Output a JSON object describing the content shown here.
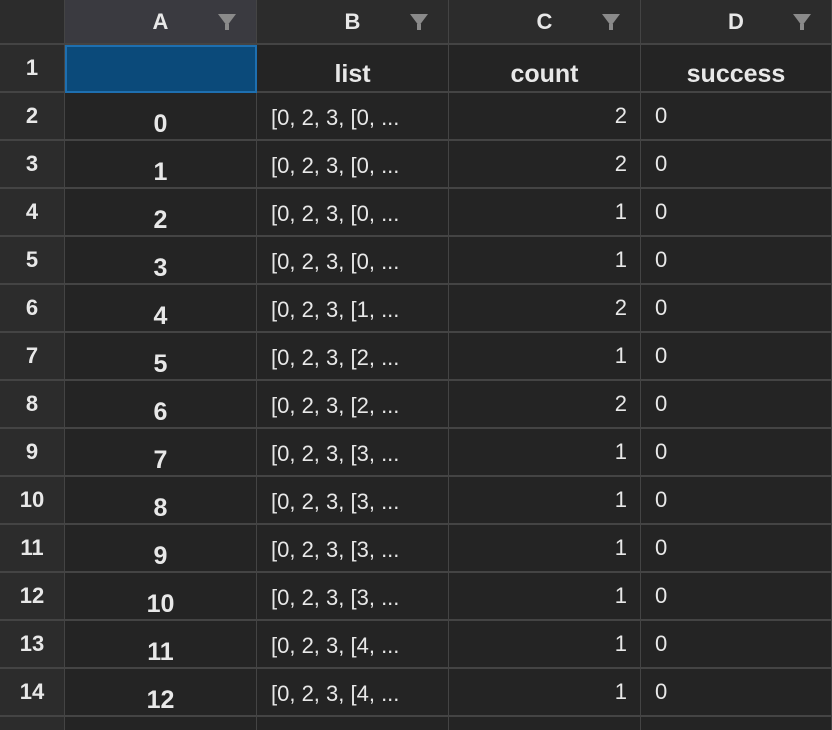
{
  "columns": [
    {
      "letter": "A"
    },
    {
      "letter": "B"
    },
    {
      "letter": "C"
    },
    {
      "letter": "D"
    }
  ],
  "header_row": {
    "row_number": "1",
    "index": "",
    "list": "list",
    "count": "count",
    "success": "success"
  },
  "rows": [
    {
      "row_number": "2",
      "index": "0",
      "list": "[0, 2, 3, [0, ...",
      "count": "2",
      "success": "0"
    },
    {
      "row_number": "3",
      "index": "1",
      "list": "[0, 2, 3, [0, ...",
      "count": "2",
      "success": "0"
    },
    {
      "row_number": "4",
      "index": "2",
      "list": "[0, 2, 3, [0, ...",
      "count": "1",
      "success": "0"
    },
    {
      "row_number": "5",
      "index": "3",
      "list": "[0, 2, 3, [0, ...",
      "count": "1",
      "success": "0"
    },
    {
      "row_number": "6",
      "index": "4",
      "list": "[0, 2, 3, [1, ...",
      "count": "2",
      "success": "0"
    },
    {
      "row_number": "7",
      "index": "5",
      "list": "[0, 2, 3, [2, ...",
      "count": "1",
      "success": "0"
    },
    {
      "row_number": "8",
      "index": "6",
      "list": "[0, 2, 3, [2, ...",
      "count": "2",
      "success": "0"
    },
    {
      "row_number": "9",
      "index": "7",
      "list": "[0, 2, 3, [3, ...",
      "count": "1",
      "success": "0"
    },
    {
      "row_number": "10",
      "index": "8",
      "list": "[0, 2, 3, [3, ...",
      "count": "1",
      "success": "0"
    },
    {
      "row_number": "11",
      "index": "9",
      "list": "[0, 2, 3, [3, ...",
      "count": "1",
      "success": "0"
    },
    {
      "row_number": "12",
      "index": "10",
      "list": "[0, 2, 3, [3, ...",
      "count": "1",
      "success": "0"
    },
    {
      "row_number": "13",
      "index": "11",
      "list": "[0, 2, 3, [4, ...",
      "count": "1",
      "success": "0"
    },
    {
      "row_number": "14",
      "index": "12",
      "list": "[0, 2, 3, [4, ...",
      "count": "1",
      "success": "0"
    }
  ],
  "colors": {
    "background": "#1e1e1e",
    "header_background": "#2c2c2c",
    "active_column_header": "#3a3a40",
    "cell_background": "#242424",
    "selection": "#0b4a7a",
    "gridline": "#444444",
    "text": "#e8e8e8",
    "filter_icon": "#8a8a8a"
  },
  "icons": {
    "filter": "filter-funnel-icon"
  },
  "selection": {
    "active_cell": "A1",
    "active_column": "A"
  }
}
